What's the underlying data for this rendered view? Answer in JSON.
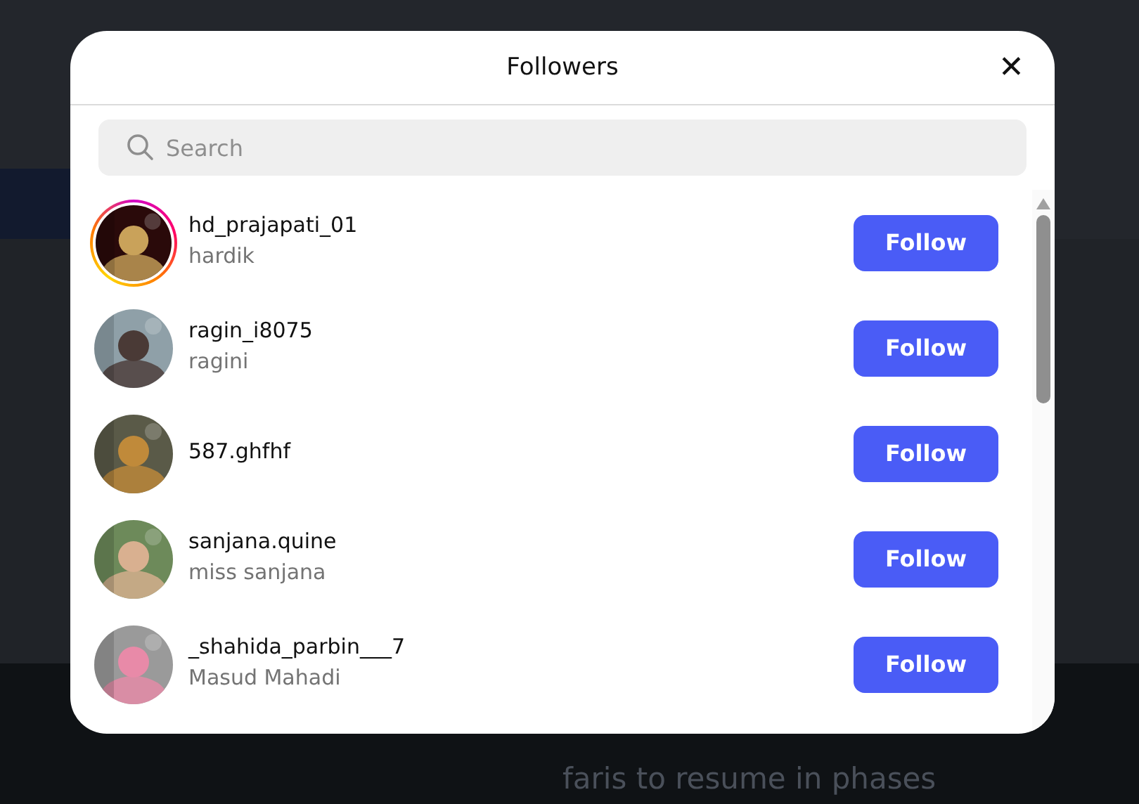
{
  "background": {
    "headline": "faris to resume in phases"
  },
  "dialog": {
    "title": "Followers",
    "close": "✕"
  },
  "search": {
    "placeholder": "Search"
  },
  "followers": [
    {
      "username": "hd_prajapati_01",
      "name": "hardik",
      "story_ring": true,
      "button": "Follow"
    },
    {
      "username": "ragin_i8075",
      "name": "ragini",
      "story_ring": false,
      "button": "Follow"
    },
    {
      "username": "587.ghfhf",
      "story_ring": false,
      "button": "Follow"
    },
    {
      "username": "sanjana.quine",
      "name": "miss sanjana",
      "story_ring": false,
      "button": "Follow"
    },
    {
      "username": "_shahida_parbin___7",
      "name": "Masud Mahadi",
      "story_ring": false,
      "button": "Follow"
    }
  ]
}
